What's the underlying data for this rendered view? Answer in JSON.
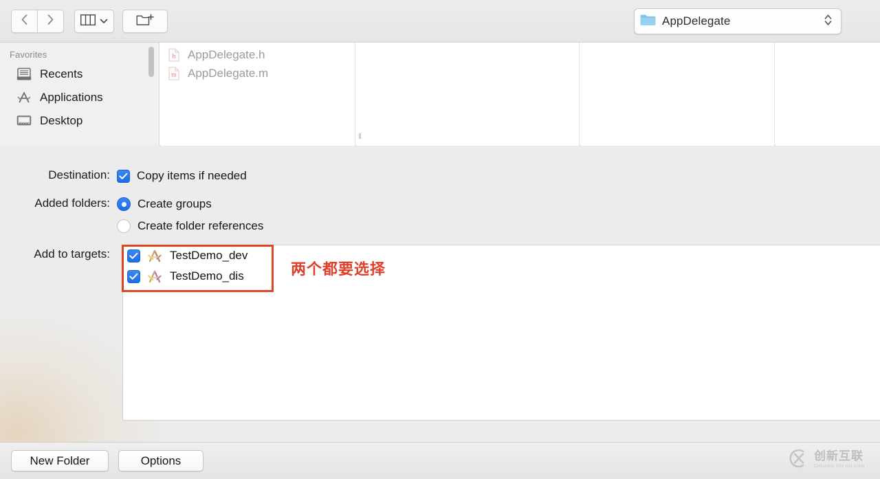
{
  "toolbar": {
    "back_label": "Back",
    "forward_label": "Forward",
    "view_label": "Column view",
    "new_folder_label": "New Folder",
    "path_popup": {
      "label": "AppDelegate",
      "icon": "folder-icon",
      "stepper_icon": "stepper-up-down-icon"
    },
    "icons": {
      "back": "chevron-left-icon",
      "forward": "chevron-right-icon",
      "view": "column-view-icon",
      "view_chevron": "chevron-down-icon",
      "new_folder": "new-folder-icon"
    }
  },
  "browser": {
    "sidebar": {
      "header": "Favorites",
      "items": [
        {
          "label": "Recents",
          "icon": "recents-icon"
        },
        {
          "label": "Applications",
          "icon": "applications-icon"
        },
        {
          "label": "Desktop",
          "icon": "desktop-icon"
        }
      ]
    },
    "columns": [
      {
        "files": [
          {
            "name": "AppDelegate.h",
            "icon": "header-file-icon",
            "badge": "h"
          },
          {
            "name": "AppDelegate.m",
            "icon": "objc-file-icon",
            "badge": "m"
          }
        ]
      },
      {
        "files": []
      },
      {
        "files": []
      },
      {
        "files": []
      }
    ],
    "resize_grip": "‖"
  },
  "form": {
    "destination": {
      "label": "Destination:",
      "option": {
        "text": "Copy items if needed",
        "checked": true
      }
    },
    "added_folders": {
      "label": "Added folders:",
      "options": [
        {
          "text": "Create groups",
          "selected": true
        },
        {
          "text": "Create folder references",
          "selected": false
        }
      ]
    },
    "add_to_targets": {
      "label": "Add to targets:",
      "targets": [
        {
          "name": "TestDemo_dev",
          "checked": true,
          "icon": "xcode-target-icon"
        },
        {
          "name": "TestDemo_dis",
          "checked": true,
          "icon": "xcode-target-icon"
        }
      ]
    }
  },
  "annotation": {
    "text": "两个都要选择",
    "color": "#e0402a",
    "highlight_color": "#e04522"
  },
  "bottom_bar": {
    "new_folder_label": "New Folder",
    "options_label": "Options"
  },
  "watermark": {
    "cn": "创新互联",
    "en": "CHUANG XIN HU LIAN",
    "icon": "cx-logo-icon"
  },
  "colors": {
    "accent": "#1f6ce6",
    "annotation_red": "#e0402a",
    "window_bg": "#ececec",
    "panel_bg": "#ffffff"
  }
}
